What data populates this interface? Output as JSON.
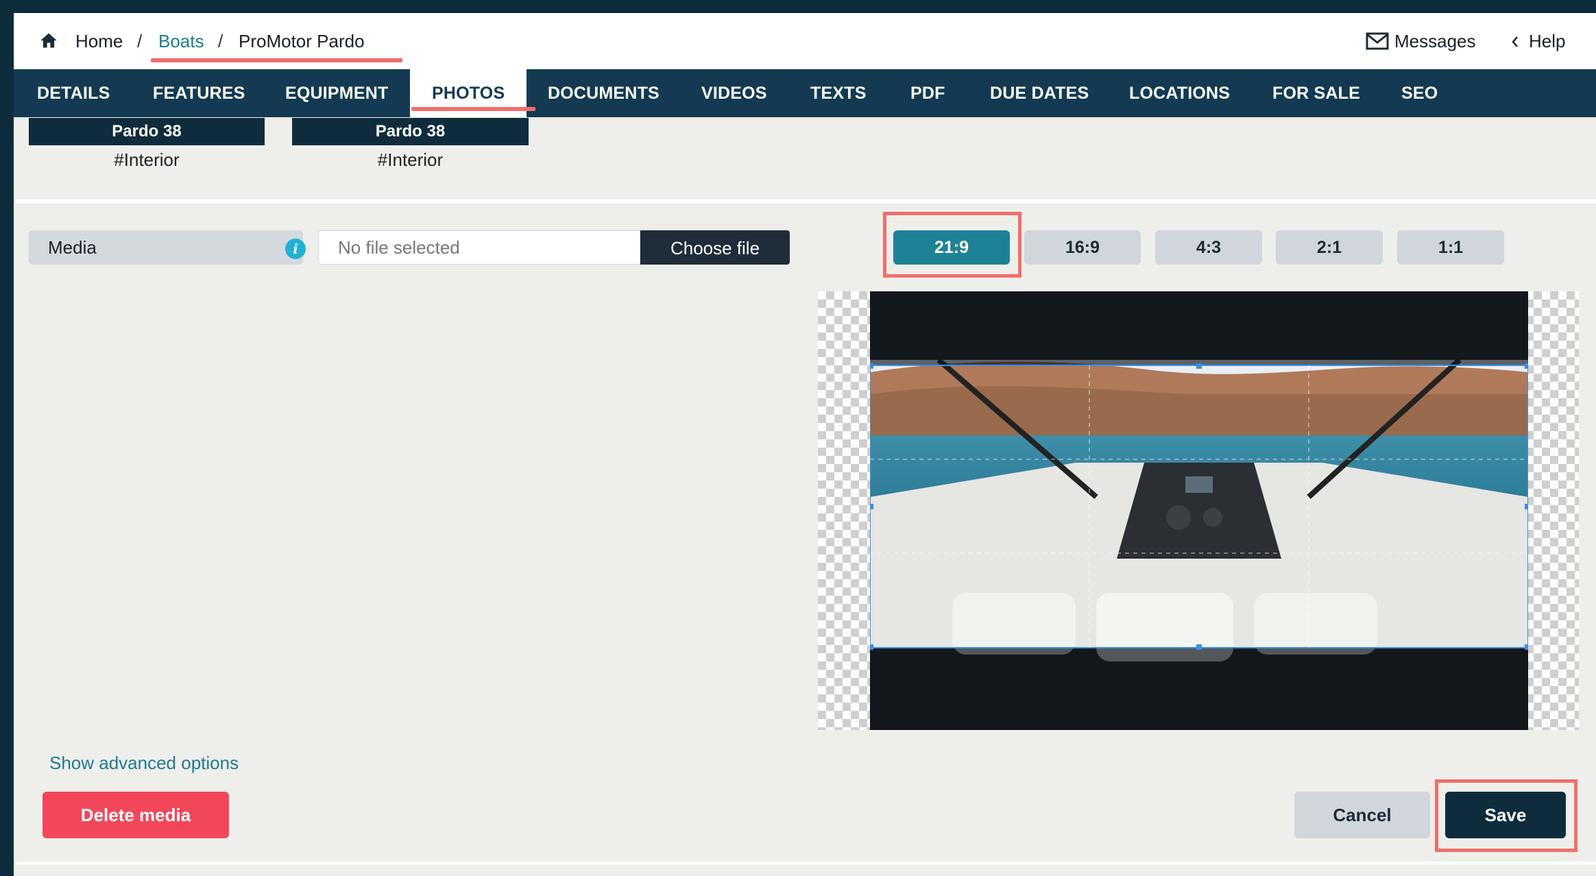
{
  "breadcrumb": {
    "home": "Home",
    "separator": "/",
    "boats": "Boats",
    "current": "ProMotor Pardo"
  },
  "header_right": {
    "messages": "Messages",
    "help": "Help"
  },
  "tabs": [
    {
      "label": "DETAILS",
      "active": false
    },
    {
      "label": "FEATURES",
      "active": false
    },
    {
      "label": "EQUIPMENT",
      "active": false
    },
    {
      "label": "PHOTOS",
      "active": true
    },
    {
      "label": "DOCUMENTS",
      "active": false
    },
    {
      "label": "VIDEOS",
      "active": false
    },
    {
      "label": "TEXTS",
      "active": false
    },
    {
      "label": "PDF",
      "active": false
    },
    {
      "label": "DUE DATES",
      "active": false
    },
    {
      "label": "LOCATIONS",
      "active": false
    },
    {
      "label": "FOR SALE",
      "active": false
    },
    {
      "label": "SEO",
      "active": false
    }
  ],
  "thumbnails": [
    {
      "title": "Pardo 38",
      "tag": "#Interior"
    },
    {
      "title": "Pardo 38",
      "tag": "#Interior"
    }
  ],
  "media": {
    "label": "Media",
    "file_placeholder": "No file selected",
    "choose_file": "Choose file"
  },
  "aspect_ratios": [
    {
      "label": "21:9",
      "active": true
    },
    {
      "label": "16:9",
      "active": false
    },
    {
      "label": "4:3",
      "active": false
    },
    {
      "label": "2:1",
      "active": false
    },
    {
      "label": "1:1",
      "active": false
    }
  ],
  "links": {
    "advanced": "Show advanced options"
  },
  "actions": {
    "delete": "Delete media",
    "cancel": "Cancel",
    "save": "Save"
  },
  "colors": {
    "navbar": "#133a52",
    "accent_teal": "#1e8296",
    "highlight": "#ef6f6c",
    "delete_red": "#f2475b"
  }
}
